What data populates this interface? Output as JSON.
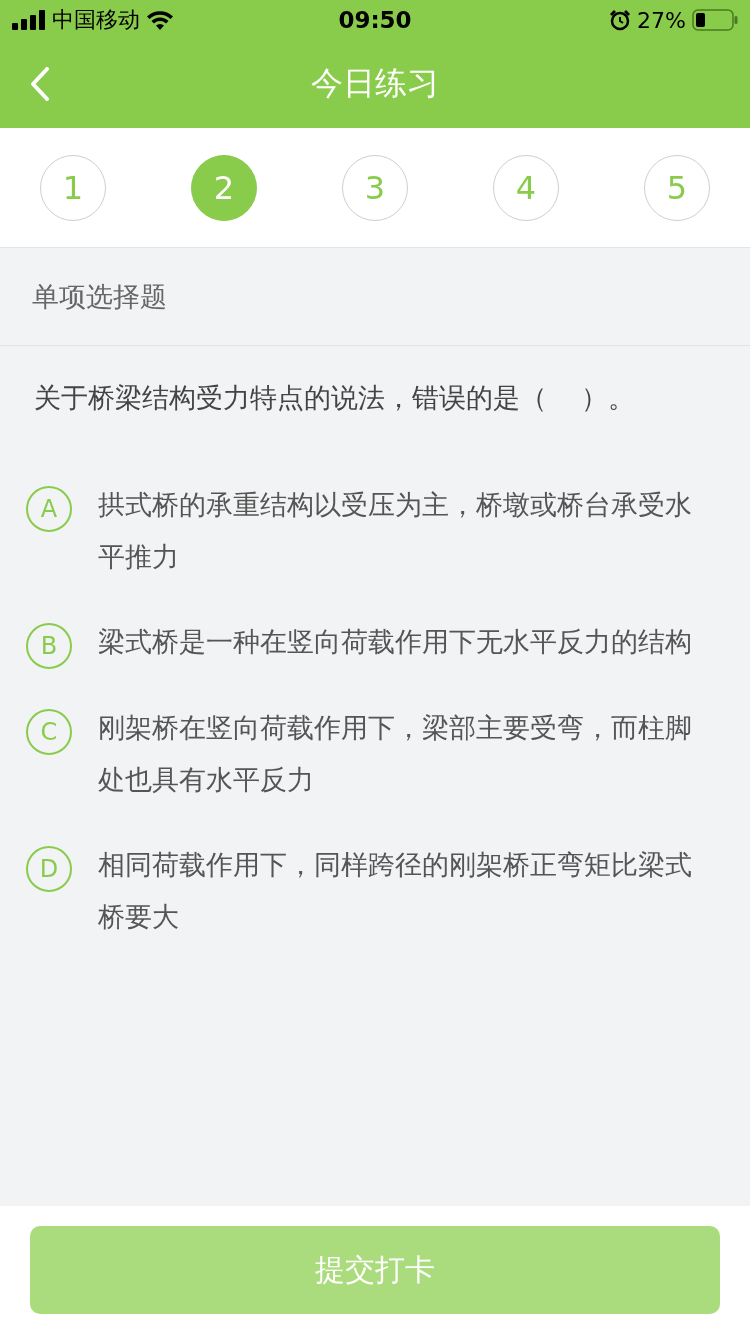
{
  "status_bar": {
    "carrier": "中国移动",
    "time": "09:50",
    "battery": "27%"
  },
  "header": {
    "title": "今日练习"
  },
  "question_tabs": [
    {
      "label": "1",
      "selected": false
    },
    {
      "label": "2",
      "selected": true
    },
    {
      "label": "3",
      "selected": false
    },
    {
      "label": "4",
      "selected": false
    },
    {
      "label": "5",
      "selected": false
    }
  ],
  "question_type": "单项选择题",
  "question": "关于桥梁结构受力特点的说法，错误的是（    ）。",
  "options": [
    {
      "letter": "A",
      "text": "拱式桥的承重结构以受压为主，桥墩或桥台承受水平推力",
      "selected": false
    },
    {
      "letter": "B",
      "text": "梁式桥是一种在竖向荷载作用下无水平反力的结构",
      "selected": false
    },
    {
      "letter": "C",
      "text": "刚架桥在竖向荷载作用下，梁部主要受弯，而柱脚处也具有水平反力",
      "selected": false
    },
    {
      "letter": "D",
      "text": "相同荷载作用下，同样跨径的刚架桥正弯矩比梁式桥要大",
      "selected": false
    }
  ],
  "submit_button": {
    "label": "提交打卡",
    "disabled": true
  }
}
